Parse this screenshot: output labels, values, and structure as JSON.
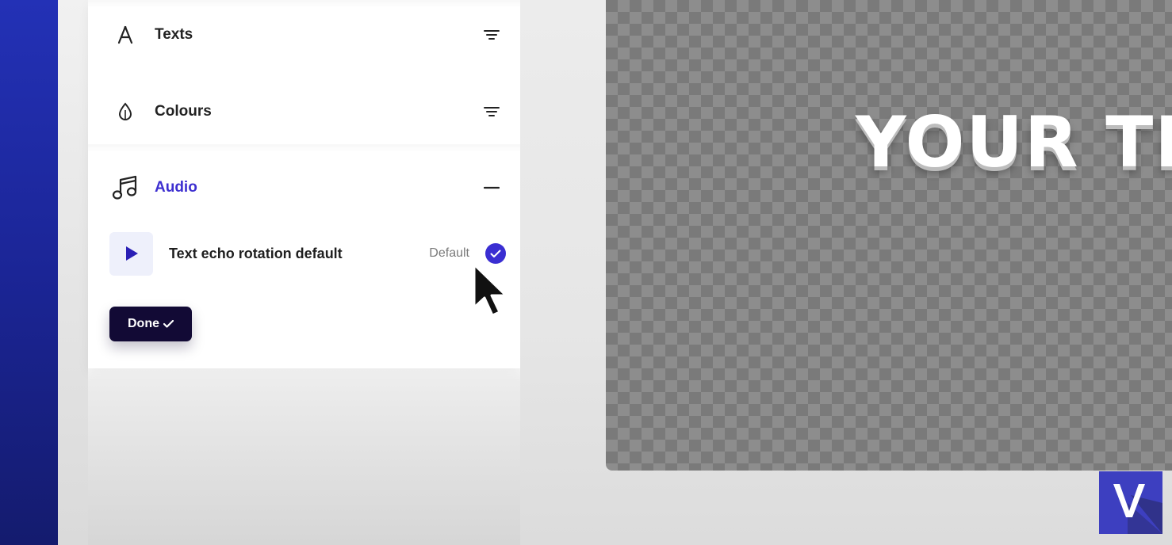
{
  "sidebar": {
    "sections": [
      {
        "label": "Texts",
        "icon": "text-font-icon",
        "right_icon": "filter-icon"
      },
      {
        "label": "Colours",
        "icon": "drop-icon",
        "right_icon": "filter-icon"
      },
      {
        "label": "Audio",
        "icon": "music-note-icon",
        "right_icon": "minus-icon"
      }
    ],
    "audio": {
      "item_title": "Text echo rotation default",
      "item_tag": "Default",
      "selected": true
    },
    "done_label": "Done"
  },
  "canvas": {
    "text": "YOUR TI"
  },
  "colors": {
    "accent": "#3a2ed2",
    "done_bg": "#120a35",
    "strip": "#1b2596"
  }
}
